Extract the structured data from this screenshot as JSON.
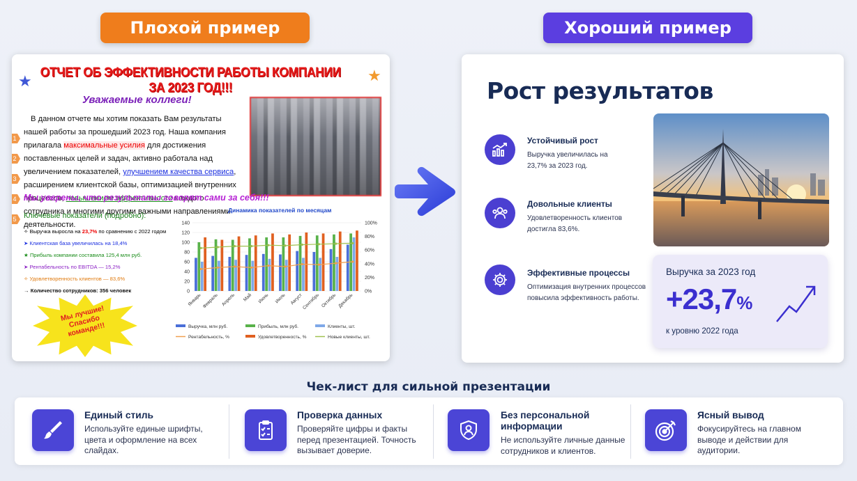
{
  "headers": {
    "bad": "Плохой пример",
    "good": "Хороший пример"
  },
  "bad_slide": {
    "title": "ОТЧЕТ ОБ ЭФФЕКТИВНОСТИ РАБОТЫ КОМПАНИИ ЗА 2023 ГОД!!!",
    "greeting": "Уважаемые коллеги!",
    "para": {
      "p1": "В данном отчете мы хотим показать Вам результаты нашей работы за прошедший 2023 год. Наша компания прилагала ",
      "hl1": "максимальные усилия",
      "p2": " для достижения поставленных целей и задач, активно работала над увеличением показателей, ",
      "hl2": "улучшением качества сервиса",
      "p3": ", расширением клиентской базы, оптимизацией внутренних процессов, ",
      "hl3": "повышением эффективности",
      "p4": " каждого сотрудника и многими другими важными направлениями деятельности."
    },
    "markers": [
      "1",
      "2",
      "3",
      "4",
      "5"
    ],
    "sure_text": "Мы уверены, что результаты говорят сами за себя!!!",
    "kp_title": "Ключевые показатели (подробно):",
    "kp_items": [
      {
        "prefix": "Выручка выросла на ",
        "value": "23,7%",
        "suffix": " по сравнению с 2022 годом",
        "color": "#111111",
        "bullet": "✧"
      },
      {
        "text": "Клиентская база увеличилась на 18,4%",
        "color": "#1b2fe0",
        "bullet": "➤"
      },
      {
        "text": "Прибыль компании составила 125,4 млн руб.",
        "color": "#1a8c1a",
        "bullet": "★"
      },
      {
        "text": "Рентабельность по EBITDA — 15,2%",
        "color": "#8a1fc4",
        "bullet": "➤"
      },
      {
        "text": "Удовлетворенность клиентов — 83,6%",
        "color": "#e07b10",
        "bullet": "✧"
      },
      {
        "text": "Количество сотрудников: 356 человек",
        "color": "#111111",
        "bullet": "→"
      }
    ],
    "burst_text": "Мы лучшие! Спасибо команде!!!",
    "chart_title": "Динамика показателей по месяцам"
  },
  "chart_data": {
    "type": "bar",
    "title": "Динамика показателей по месяцам",
    "categories": [
      "Январь",
      "Февраль",
      "Апрель",
      "Май",
      "Июнь",
      "Июль",
      "Август",
      "Сентябрь",
      "Октябрь",
      "Декабрь"
    ],
    "ylim": [
      0,
      140
    ],
    "y_ticks": [
      "140",
      "120",
      "100",
      "80",
      "60",
      "40",
      "20",
      "0"
    ],
    "y2_ticks": [
      "100%",
      "80%",
      "60%",
      "40%",
      "20%",
      "0%"
    ],
    "series": [
      {
        "name": "Выручка, млн руб.",
        "color": "#4a6fd8",
        "values": [
          68,
          72,
          70,
          74,
          76,
          75,
          82,
          80,
          86,
          95
        ]
      },
      {
        "name": "Прибыль, млн руб.",
        "color": "#59b24a",
        "values": [
          100,
          106,
          105,
          108,
          110,
          110,
          113,
          114,
          116,
          118
        ]
      },
      {
        "name": "Клиенты, шт.",
        "color": "#7fa8e8",
        "values": [
          60,
          62,
          64,
          62,
          66,
          64,
          68,
          68,
          70,
          110
        ]
      },
      {
        "name": "Рентабельность, %",
        "color": "#f0a050",
        "values": [
          45,
          48,
          50,
          48,
          52,
          50,
          55,
          54,
          57,
          60
        ]
      },
      {
        "name": "Удовлетворенность, %",
        "color": "#e06020",
        "values": [
          110,
          105,
          112,
          114,
          118,
          116,
          120,
          118,
          122,
          124
        ]
      },
      {
        "name": "Новые клиенты, шт.",
        "color": "#a0c050",
        "values": [
          88,
          90,
          92,
          92,
          94,
          93,
          95,
          96,
          97,
          98
        ]
      }
    ],
    "legend": [
      "Выручка, млн руб.",
      "Прибыль, млн руб.",
      "Клиенты, шт.",
      "Рентабельность, %",
      "Удовлетворенность, %",
      "Новые клиенты, шт."
    ]
  },
  "good_slide": {
    "title": "Рост результатов",
    "features": [
      {
        "title": "Устойчивый рост",
        "text": "Выручка увеличилась на 23,7% за 2023 год."
      },
      {
        "title": "Довольные клиенты",
        "text": "Удовлетворенность клиентов достигла 83,6%."
      },
      {
        "title": "Эффективные процессы",
        "text": "Оптимизация внутренних процессов повысила эффективность работы."
      }
    ],
    "stat": {
      "label": "Выручка за 2023 год",
      "value": "+23,7",
      "unit": "%",
      "sub": "к уровню 2022 года"
    }
  },
  "checklist": {
    "title": "Чек-лист для сильной презентации",
    "items": [
      {
        "title": "Единый стиль",
        "text": "Используйте единые шрифты, цвета и оформление на всех слайдах."
      },
      {
        "title": "Проверка данных",
        "text": "Проверяйте цифры и факты перед презентацией. Точность вызывает доверие."
      },
      {
        "title": "Без персональной информации",
        "text": "Не используйте личные данные сотрудников и клиентов."
      },
      {
        "title": "Ясный вывод",
        "text": "Фокусируйтесь на главном выводе и действии для аудитории."
      }
    ]
  }
}
